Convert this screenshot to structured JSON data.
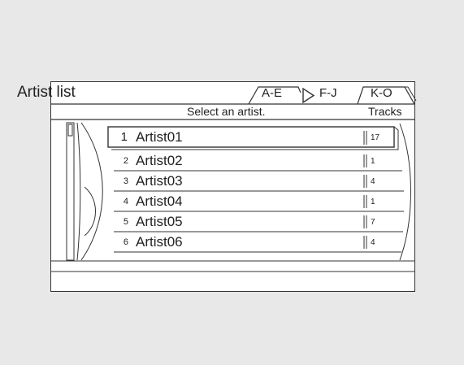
{
  "screen": {
    "title": "Artist list",
    "prompt": "Select an artist.",
    "tracks_header": "Tracks"
  },
  "tabs": [
    {
      "label": "A-E",
      "selected": false
    },
    {
      "label": "F-J",
      "selected": true
    },
    {
      "label": "K-O",
      "selected": false
    }
  ],
  "selected_tab_icon": "play-triangle-icon",
  "artists": [
    {
      "num": "1",
      "name": "Artist01",
      "tracks": "17",
      "highlighted": true
    },
    {
      "num": "2",
      "name": "Artist02",
      "tracks": "1",
      "highlighted": false
    },
    {
      "num": "3",
      "name": "Artist03",
      "tracks": "4",
      "highlighted": false
    },
    {
      "num": "4",
      "name": "Artist04",
      "tracks": "1",
      "highlighted": false
    },
    {
      "num": "5",
      "name": "Artist05",
      "tracks": "7",
      "highlighted": false
    },
    {
      "num": "6",
      "name": "Artist06",
      "tracks": "4",
      "highlighted": false
    }
  ]
}
